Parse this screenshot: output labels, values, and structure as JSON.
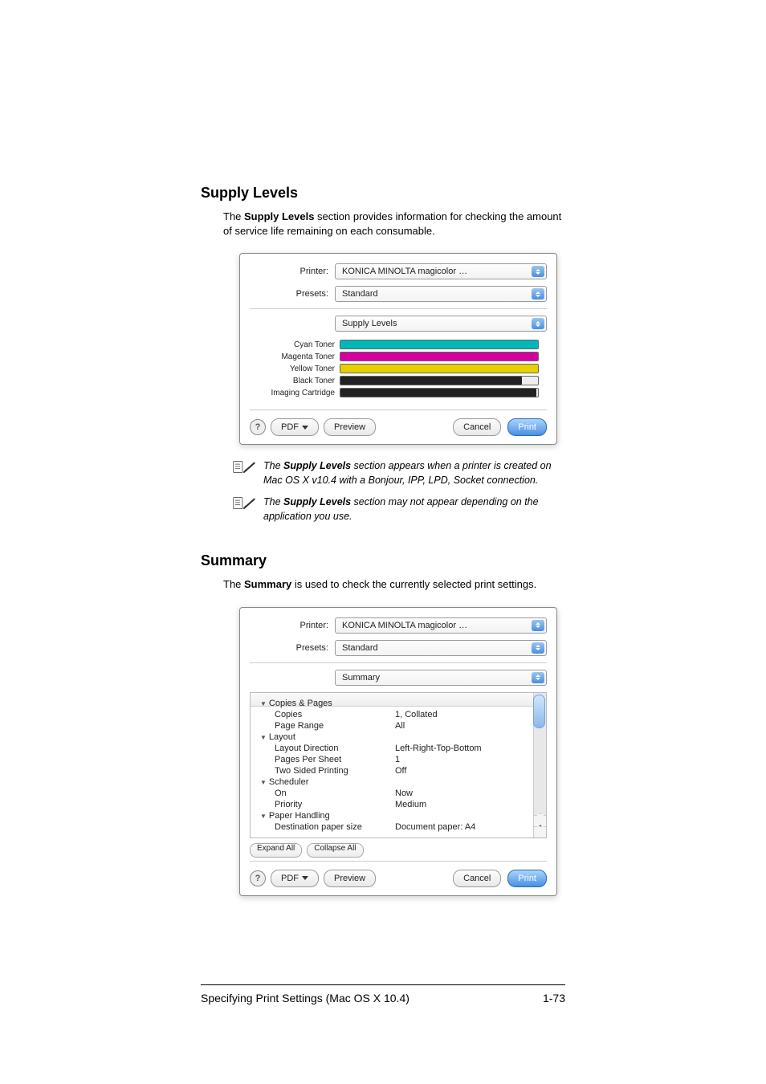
{
  "headings": {
    "supply_levels": "Supply Levels",
    "summary": "Summary"
  },
  "intro": {
    "supply_pre": "The ",
    "supply_bold": "Supply Levels",
    "supply_post": " section provides information for checking the amount of service life remaining on each consumable.",
    "summary_pre": "The ",
    "summary_bold": "Summary",
    "summary_post": " is used to check the currently selected print settings."
  },
  "notes": {
    "n1_pre": "The ",
    "n1_bold": "Supply Levels",
    "n1_post": " section appears when a printer is created on Mac OS X v10.4 with a Bonjour, IPP, LPD, Socket connection.",
    "n2_pre": "The ",
    "n2_bold": "Supply Levels",
    "n2_post": " section may not appear depending on the application you use."
  },
  "dialog": {
    "labels": {
      "printer": "Printer:",
      "presets": "Presets:"
    },
    "printer_value": "KONICA MINOLTA magicolor …",
    "presets_value": "Standard",
    "panel1": "Supply Levels",
    "panel2": "Summary",
    "buttons": {
      "pdf": "PDF",
      "preview": "Preview",
      "cancel": "Cancel",
      "print": "Print",
      "expand": "Expand All",
      "collapse": "Collapse All"
    },
    "supplies": [
      {
        "label": "Cyan Toner",
        "color": "#00b8b8",
        "percent": 100
      },
      {
        "label": "Magenta Toner",
        "color": "#d400a0",
        "percent": 100
      },
      {
        "label": "Yellow Toner",
        "color": "#e8d000",
        "percent": 100
      },
      {
        "label": "Black Toner",
        "color": "#222222",
        "percent": 92
      },
      {
        "label": "Imaging Cartridge",
        "color": "#222222",
        "percent": 99
      }
    ],
    "summary_rows": [
      {
        "type": "group",
        "k": "Copies & Pages",
        "v": ""
      },
      {
        "type": "item",
        "k": "Copies",
        "v": "1, Collated"
      },
      {
        "type": "item",
        "k": "Page Range",
        "v": "All"
      },
      {
        "type": "group",
        "k": "Layout",
        "v": ""
      },
      {
        "type": "item",
        "k": "Layout Direction",
        "v": "Left-Right-Top-Bottom"
      },
      {
        "type": "item",
        "k": "Pages Per Sheet",
        "v": "1"
      },
      {
        "type": "item",
        "k": "Two Sided Printing",
        "v": "Off"
      },
      {
        "type": "group",
        "k": "Scheduler",
        "v": ""
      },
      {
        "type": "item",
        "k": "On",
        "v": "Now"
      },
      {
        "type": "item",
        "k": "Priority",
        "v": "Medium"
      },
      {
        "type": "group",
        "k": "Paper Handling",
        "v": ""
      },
      {
        "type": "item",
        "k": "Destination paper size",
        "v": "Document paper: A4"
      }
    ]
  },
  "footer": {
    "left": "Specifying Print Settings (Mac OS X 10.4)",
    "right": "1-73"
  }
}
